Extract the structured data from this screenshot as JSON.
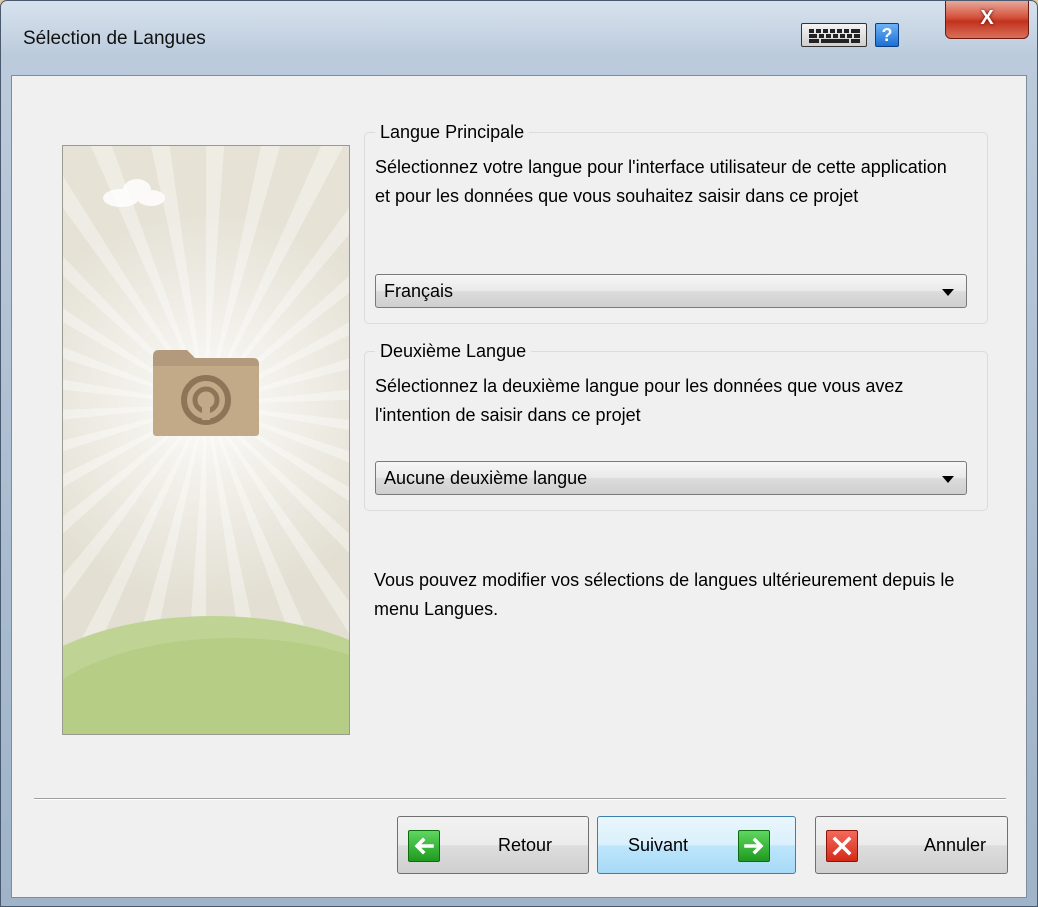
{
  "window": {
    "title": "Sélection de Langues",
    "close_label": "X",
    "help_label": "?"
  },
  "primary_language": {
    "legend": "Langue Principale",
    "description": "Sélectionnez votre langue pour l'interface utilisateur de cette application et pour les données que vous souhaitez saisir dans ce projet",
    "selected": "Français"
  },
  "second_language": {
    "legend": "Deuxième Langue",
    "description": "Sélectionnez la deuxième langue pour les données que vous avez l'intention de saisir dans ce projet",
    "selected": "Aucune deuxième langue"
  },
  "note": "Vous pouvez modifier vos sélections de langues ultérieurement depuis le menu Langues.",
  "buttons": {
    "back_label": "Retour",
    "next_label": "Suivant",
    "cancel_label": "Annuler"
  },
  "icons": {
    "keyboard": "keyboard-icon",
    "help": "help-icon",
    "close": "close-icon",
    "back": "arrow-left-icon",
    "next": "arrow-right-icon",
    "cancel": "x-icon",
    "banner_folder": "folder-icon",
    "banner_cloud": "cloud-icon"
  },
  "colors": {
    "green_icon": "#2fb52f",
    "red_icon": "#e23b28",
    "primary_button": "#bee6fd",
    "close_button": "#c2321d"
  }
}
